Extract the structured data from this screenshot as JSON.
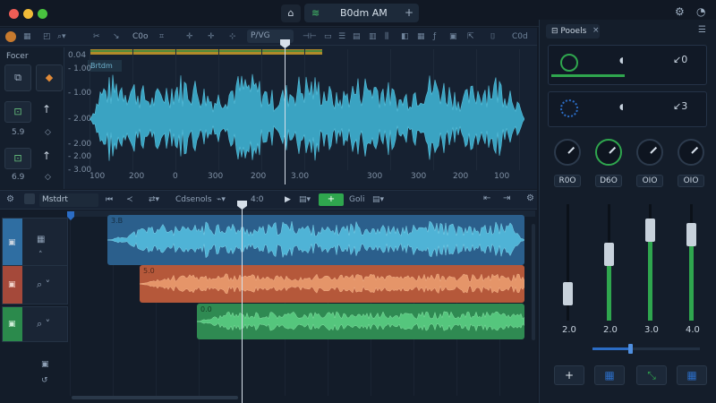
{
  "titlebar": {
    "tab_title": "B0dm AM",
    "tab_icon": "waveform-icon",
    "home_icon": "home-icon"
  },
  "toolbar": {
    "tool_a": "C0o",
    "tool_b": "P/VG",
    "zoom": "C0d"
  },
  "side_panel": {
    "title": "Focer",
    "value_1": "5.9",
    "value_2": "6.9"
  },
  "editor": {
    "region_label": "Brtdm",
    "ruler_top": "0.04",
    "y_axis": [
      "- 1.00",
      "- 1.00",
      "- 2.00",
      "- 2.00",
      "- 2.00",
      "- 3.00"
    ],
    "x_axis": [
      "100",
      "200",
      "0",
      "300",
      "200",
      "3.00",
      "300",
      "300",
      "200",
      "100"
    ]
  },
  "arrange": {
    "track_name": "Mstdrt",
    "mode": "Cdsenols",
    "position": "4:0",
    "snap": "Goli",
    "clips": [
      {
        "label": "3.B",
        "color": "#3a87b8",
        "wave": "#58c0dc"
      },
      {
        "label": "5.0",
        "color": "#c0623f",
        "wave": "#e79c6e"
      },
      {
        "label": "0.0",
        "color": "#37955a",
        "wave": "#5fcf86"
      }
    ]
  },
  "mixer": {
    "tab_label": "Pooels",
    "send_1": "0",
    "send_2": "3",
    "knobs": [
      "R0O",
      "D6O",
      "OIO",
      "OIO"
    ],
    "faders": [
      {
        "label": "2.0",
        "level": 0.0
      },
      {
        "label": "2.0",
        "level": 0.55
      },
      {
        "label": "3.0",
        "level": 0.8
      },
      {
        "label": "4.0",
        "level": 0.75
      }
    ],
    "master_level": 0.35,
    "colors": {
      "accent_green": "#2fa64e",
      "accent_blue": "#2b6cc4"
    }
  }
}
